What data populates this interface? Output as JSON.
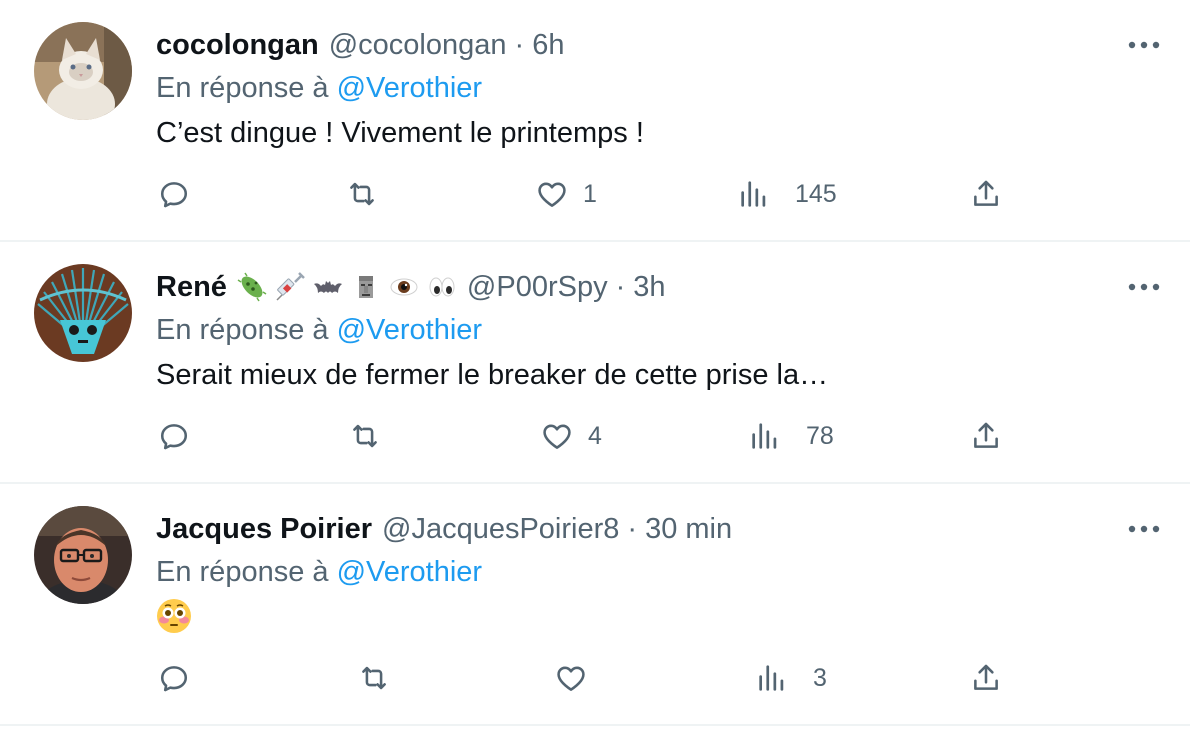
{
  "tweets": [
    {
      "name": "cocolongan",
      "handle": "@cocolongan",
      "time": "6h",
      "reply_prefix": "En réponse à",
      "reply_handle": "@Verothier",
      "text": "C’est dingue ! Vivement le printemps !",
      "likes": "1",
      "views": "145",
      "avatar": "cat-avatar"
    },
    {
      "name": "René",
      "name_emojis": [
        "microbe",
        "syringe",
        "bat",
        "moai",
        "eye",
        "eyes"
      ],
      "handle": "@P00rSpy",
      "time": "3h",
      "reply_prefix": "En réponse à",
      "reply_handle": "@Verothier",
      "text": "Serait mieux de fermer le breaker de cette prise la…",
      "likes": "4",
      "views": "78",
      "avatar": "rake-face-avatar"
    },
    {
      "name": "Jacques Poirier",
      "handle": "@JacquesPoirier8",
      "time": "30 min",
      "reply_prefix": "En réponse à",
      "reply_handle": "@Verothier",
      "text_emoji": "flushed-face",
      "likes": "",
      "views": "3",
      "avatar": "man-glasses-avatar"
    }
  ],
  "separator": "·",
  "colors": {
    "link": "#1d9bf0",
    "secondary": "#536471",
    "primary": "#0f1419",
    "divider": "#eff3f4"
  }
}
